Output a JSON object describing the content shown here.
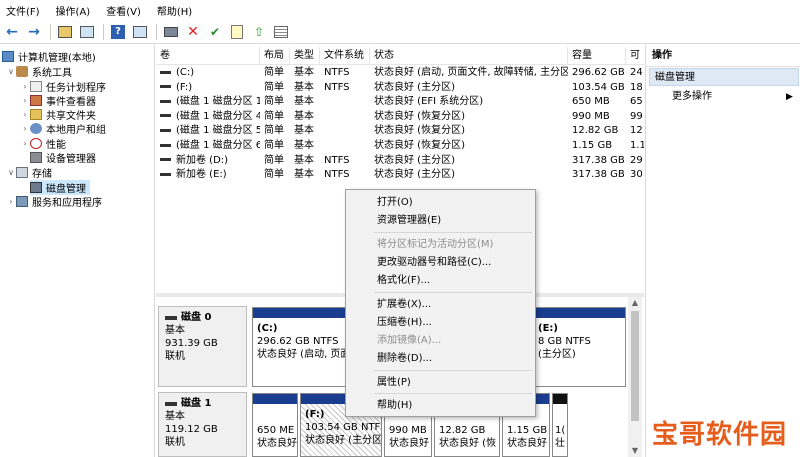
{
  "menubar": {
    "items": [
      "文件(F)",
      "操作(A)",
      "查看(V)",
      "帮助(H)"
    ]
  },
  "toolbar": {
    "icons": [
      "back-arrow-icon",
      "forward-arrow-icon",
      "up-folder-icon",
      "console-tree-icon",
      "help-icon",
      "properties-icon",
      "connect-icon",
      "delete-icon",
      "check-icon",
      "new-doc-icon",
      "export-icon",
      "import-icon"
    ]
  },
  "tree": {
    "root": "计算机管理(本地)",
    "system_tools": "系统工具",
    "task_scheduler": "任务计划程序",
    "event_viewer": "事件查看器",
    "shared_folders": "共享文件夹",
    "local_users": "本地用户和组",
    "performance": "性能",
    "device_manager": "设备管理器",
    "storage": "存储",
    "disk_management": "磁盘管理",
    "services": "服务和应用程序"
  },
  "volume_table": {
    "headers": {
      "volume": "卷",
      "layout": "布局",
      "type": "类型",
      "fs": "文件系统",
      "status": "状态",
      "capacity": "容量",
      "free": "可"
    },
    "rows": [
      {
        "volume": "(C:)",
        "layout": "简单",
        "type": "基本",
        "fs": "NTFS",
        "status": "状态良好 (启动, 页面文件, 故障转储, 主分区)",
        "capacity": "296.62 GB",
        "free": "24"
      },
      {
        "volume": "(F:)",
        "layout": "简单",
        "type": "基本",
        "fs": "NTFS",
        "status": "状态良好 (主分区)",
        "capacity": "103.54 GB",
        "free": "18"
      },
      {
        "volume": "(磁盘 1 磁盘分区 1)",
        "layout": "简单",
        "type": "基本",
        "fs": "",
        "status": "状态良好 (EFI 系统分区)",
        "capacity": "650 MB",
        "free": "65"
      },
      {
        "volume": "(磁盘 1 磁盘分区 4)",
        "layout": "简单",
        "type": "基本",
        "fs": "",
        "status": "状态良好 (恢复分区)",
        "capacity": "990 MB",
        "free": "99"
      },
      {
        "volume": "(磁盘 1 磁盘分区 5)",
        "layout": "简单",
        "type": "基本",
        "fs": "",
        "status": "状态良好 (恢复分区)",
        "capacity": "12.82 GB",
        "free": "12"
      },
      {
        "volume": "(磁盘 1 磁盘分区 6)",
        "layout": "简单",
        "type": "基本",
        "fs": "",
        "status": "状态良好 (恢复分区)",
        "capacity": "1.15 GB",
        "free": "1.1"
      },
      {
        "volume": "新加卷 (D:)",
        "layout": "简单",
        "type": "基本",
        "fs": "NTFS",
        "status": "状态良好 (主分区)",
        "capacity": "317.38 GB",
        "free": "29"
      },
      {
        "volume": "新加卷 (E:)",
        "layout": "简单",
        "type": "基本",
        "fs": "NTFS",
        "status": "状态良好 (主分区)",
        "capacity": "317.38 GB",
        "free": "30"
      }
    ]
  },
  "disks": {
    "disk0": {
      "name": "磁盘 0",
      "type": "基本",
      "size": "931.39 GB",
      "state": "联机"
    },
    "disk1": {
      "name": "磁盘 1",
      "type": "基本",
      "size": "119.12 GB",
      "state": "联机"
    }
  },
  "partitions": {
    "d0_c": {
      "name": "(C:)",
      "info": "296.62 GB NTFS",
      "status": "状态良好 (启动, 页面文"
    },
    "d0_e": {
      "name": "(E:)",
      "info": "8 GB NTFS",
      "status": "(主分区)"
    },
    "d1_p1": {
      "size": "650 ME",
      "status": "状态良好"
    },
    "d1_f": {
      "name": "(F:)",
      "info": "103.54 GB NTFS",
      "status": "状态良好 (主分区"
    },
    "d1_p4": {
      "size": "990 MB",
      "status": "状态良好"
    },
    "d1_p5": {
      "size": "12.82 GB",
      "status": "状态良好 (恢"
    },
    "d1_p6": {
      "size": "1.15 GB",
      "status": "状态良好"
    },
    "d1_p7": {
      "size": "1(",
      "status": "壮"
    }
  },
  "actions": {
    "header": "操作",
    "section": "磁盘管理",
    "more": "更多操作"
  },
  "context_menu": {
    "open": "打开(O)",
    "explorer": "资源管理器(E)",
    "mark_active": "将分区标记为活动分区(M)",
    "change_letter": "更改驱动器号和路径(C)...",
    "format": "格式化(F)...",
    "extend": "扩展卷(X)...",
    "shrink": "压缩卷(H)...",
    "mirror": "添加镜像(A)...",
    "delete": "删除卷(D)...",
    "properties": "属性(P)",
    "help": "帮助(H)"
  },
  "watermark": {
    "text": "宝哥软件园"
  },
  "colors": {
    "partition_bar": "#1a3d8f",
    "selection": "#cce8ff",
    "action_section": "#dfe9f5",
    "watermark": "#e65c1a"
  }
}
